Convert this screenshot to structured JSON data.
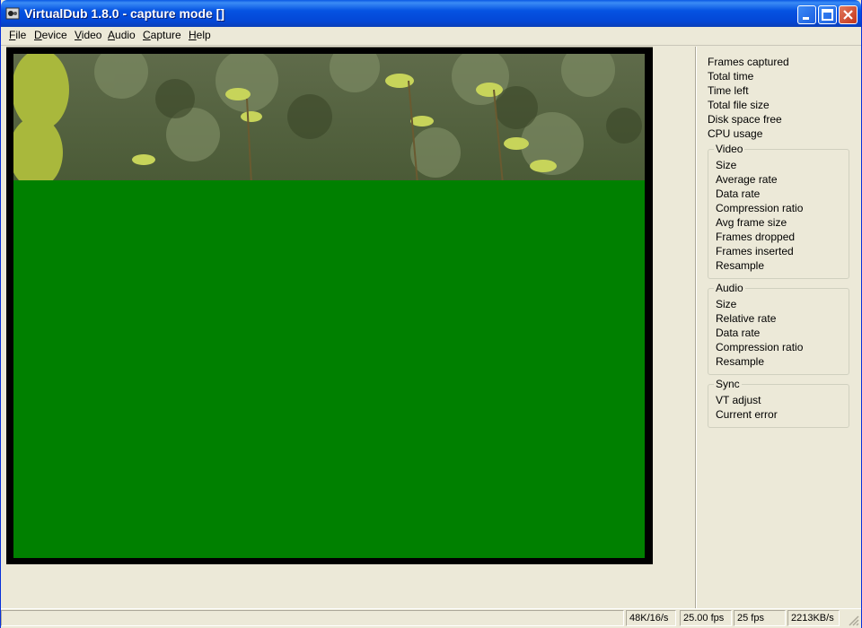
{
  "window": {
    "title": "VirtualDub 1.8.0 - capture mode []"
  },
  "menubar": {
    "items": [
      {
        "mnemonic": "F",
        "rest": "ile"
      },
      {
        "mnemonic": "D",
        "rest": "evice"
      },
      {
        "mnemonic": "V",
        "rest": "ideo"
      },
      {
        "mnemonic": "A",
        "rest": "udio"
      },
      {
        "mnemonic": "C",
        "rest": "apture"
      },
      {
        "mnemonic": "H",
        "rest": "elp"
      }
    ]
  },
  "stats": {
    "general": [
      "Frames captured",
      "Total time",
      "Time left",
      "Total file size",
      "Disk space free",
      "CPU usage"
    ],
    "video": {
      "title": "Video",
      "items": [
        "Size",
        "Average rate",
        "Data rate",
        "Compression ratio",
        "Avg frame size",
        "Frames dropped",
        "Frames inserted",
        "Resample"
      ]
    },
    "audio": {
      "title": "Audio",
      "items": [
        "Size",
        "Relative rate",
        "Data rate",
        "Compression ratio",
        "Resample"
      ]
    },
    "sync": {
      "title": "Sync",
      "items": [
        "VT adjust",
        "Current error"
      ]
    }
  },
  "statusbar": {
    "audio_format": "48K/16/s",
    "target_fps": "25.00 fps",
    "actual_fps": "25 fps",
    "data_rate": "2213KB/s"
  },
  "colors": {
    "overlay_green": "#008000",
    "titlebar_blue": "#0553e2"
  }
}
